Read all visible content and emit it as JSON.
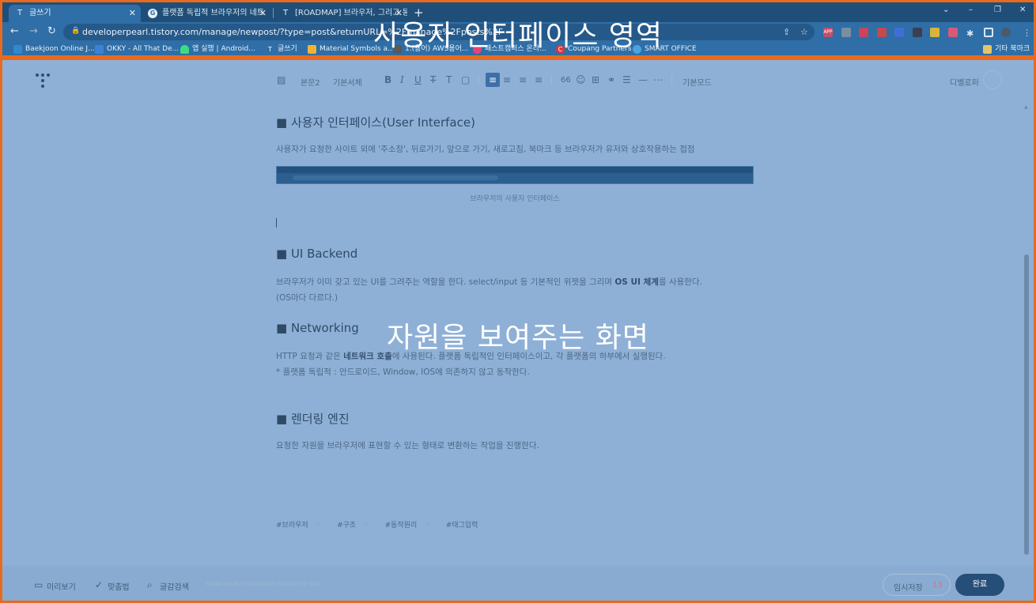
{
  "tabs": [
    {
      "title": "글쓰기",
      "favicon": "T"
    },
    {
      "title": "플랫폼 독립적 브라우저의 네트",
      "favicon": "G"
    },
    {
      "title": "[ROADMAP] 브라우저, 그리고 동",
      "favicon": "T"
    }
  ],
  "window_controls": {
    "minimize": "–",
    "maximize": "❐",
    "close": "✕",
    "tabsearch": "⌄"
  },
  "toolbar": {
    "url": "developerpearl.tistory.com/manage/newpost/?type=post&returnURL=%2Fmanage%2Fposts%2F",
    "ext_badge": "APP"
  },
  "bookmarks": [
    {
      "label": "Baekjoon Online J...",
      "color": "#2f89d0"
    },
    {
      "label": "OKKY - All That De...",
      "color": "#3b82d6"
    },
    {
      "label": "앱 실행 | Android...",
      "color": "#3ddc84"
    },
    {
      "label": "글쓰기",
      "color": "#2f6ea6"
    },
    {
      "label": "Material Symbols a...",
      "color": "#f2b233"
    },
    {
      "label": "1.(용어) AWS용어...",
      "color": "#5a5a5a"
    },
    {
      "label": "패스트캠퍼스 온라...",
      "color": "#e94374"
    },
    {
      "label": "Coupang Partners",
      "color": "#d9383a"
    },
    {
      "label": "SMART OFFICE",
      "color": "#4aa3df"
    }
  ],
  "other_bookmarks": "기타 북마크",
  "labels": {
    "chrome_region": "사용자 인터페이스 영역",
    "content_region": "자원을 보여주는 화면"
  },
  "editor_toolbar": {
    "paragraph": "본문2",
    "font": "기본서체",
    "mode": "기본모드",
    "skin": "디벨로퍼",
    "quote": "66"
  },
  "post": {
    "h1": "■ 사용자 인터페이스(User Interface)",
    "p1": "사용자가 요청한 사이트 외에 '주소창', 뒤로가기, 앞으로 가기, 새로고침, 북마크 등 브라우저가 유저와 상호작용하는 접점",
    "caption": "브라우저의 사용자 인터페이스",
    "h2": "■ UI Backend",
    "p2a": "브라우저가 이미 갖고 있는 UI를 그려주는 역할을 한다. select/input 등 기본적인 위젯을 그리며 ",
    "p2b": "OS UI 체계",
    "p2c": "를 사용한다.",
    "p2d": "(OS마다 다르다.)",
    "h3": "■ Networking",
    "p3a": "HTTP 요청과 같은 ",
    "p3b": "네트워크 호출",
    "p3c": "에 사용된다. 플랫폼 독립적인 인터페이스이고, 각 플랫폼의 하부에서 실행된다.",
    "p3d": "* 플랫폼 독립적 : 안드로이드, Window, IOS에 의존하지 않고 동작한다.",
    "h4": "■ 렌더링 엔진",
    "p4": "요청한 자원을 브라우저에 표현할 수 있는 형태로 변환하는 작업을 진행한다."
  },
  "tags": [
    "#브라우저",
    "#구조",
    "#동작원리"
  ],
  "tag_input": "#태그입력",
  "footer": {
    "preview": "미리보기",
    "spell": "맞춤법",
    "search": "글감검색",
    "copy": "KAKAO BRAIN | DOWNLOADS     POWERED BY TIME",
    "draft": "임시저장",
    "draft_count": "13",
    "publish": "완료"
  }
}
